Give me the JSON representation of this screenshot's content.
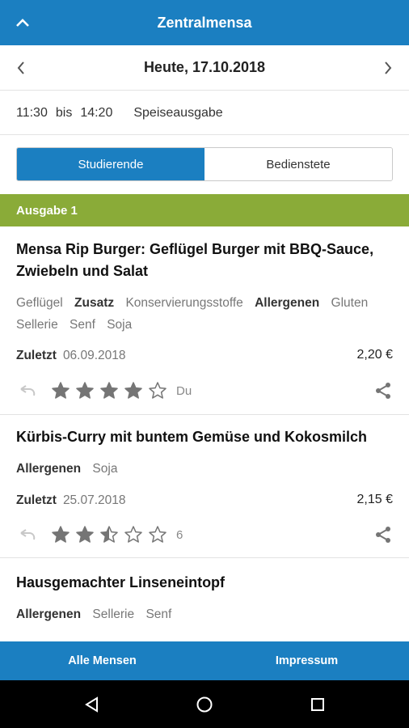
{
  "app_bar": {
    "title": "Zentralmensa"
  },
  "date_nav": {
    "date": "Heute, 17.10.2018"
  },
  "hours": {
    "from": "11:30",
    "sep": "bis",
    "to": "14:20",
    "type": "Speiseausgabe"
  },
  "audience_tabs": [
    {
      "label": "Studierende",
      "selected": true
    },
    {
      "label": "Bedienstete",
      "selected": false
    }
  ],
  "section": {
    "title": "Ausgabe 1"
  },
  "labels": {
    "zusatz": "Zusatz",
    "allergen": "Allergen",
    "zuletzt": "Zuletzt"
  },
  "meals": [
    {
      "name": "Mensa Rip Burger: Geflügel Burger mit BBQ-Sauce, Zwiebeln und Salat",
      "category": "Geflügel",
      "additives": [
        "Konservierungsstoffe"
      ],
      "allergens": [
        "Gluten",
        "Sellerie",
        "Senf",
        "Soja"
      ],
      "last_date": "06.09.2018",
      "price": "2,20 €",
      "rating": 4,
      "rating_count": "Du"
    },
    {
      "name": "Kürbis-Curry mit buntem Gemüse und Kokosmilch",
      "allergens": [
        "Soja"
      ],
      "last_date": "25.07.2018",
      "price": "2,15 €",
      "rating": 2.5,
      "rating_count": "6"
    },
    {
      "name": "Hausgemachter Linseneintopf",
      "allergens": [
        "Sellerie",
        "Senf"
      ]
    }
  ],
  "bottom_bar": {
    "all_mensen": "Alle Mensen",
    "impressum": "Impressum"
  },
  "colors": {
    "primary": "#1b7fc1",
    "section": "#8aab38",
    "star": "#757575"
  },
  "icons": [
    "chevron-up-icon",
    "chevron-left-icon",
    "chevron-right-icon",
    "undo-icon",
    "star-icon",
    "share-icon",
    "back-icon",
    "home-icon",
    "recents-icon"
  ]
}
